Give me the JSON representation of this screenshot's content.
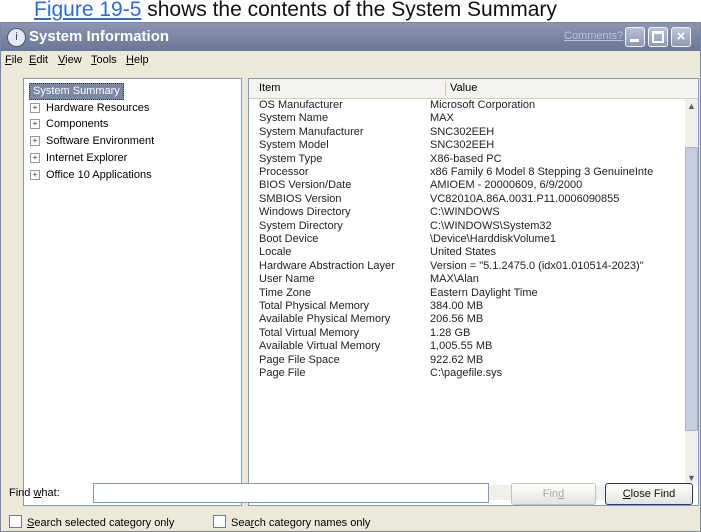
{
  "caption": {
    "link": "Figure 19-5",
    "text": " shows the contents of the System Summary"
  },
  "window": {
    "title": "System Information",
    "comments_link": "Comments?",
    "buttons": {
      "minimize_icon": "minimize-icon",
      "maximize_icon": "maximize-icon",
      "close_icon": "close-icon",
      "close_glyph": "×"
    }
  },
  "menu": {
    "file": {
      "u": "F",
      "rest": "ile"
    },
    "edit": {
      "u": "E",
      "rest": "dit"
    },
    "view": {
      "u": "V",
      "rest": "iew"
    },
    "tools": {
      "u": "T",
      "rest": "ools"
    },
    "help": {
      "u": "H",
      "rest": "elp"
    }
  },
  "tree": {
    "root": "System Summary",
    "expander": "+",
    "items": [
      "Hardware Resources",
      "Components",
      "Software Environment",
      "Internet Explorer",
      "Office 10 Applications"
    ]
  },
  "table": {
    "headers": [
      "Item",
      "Value"
    ],
    "rows": [
      [
        "OS Manufacturer",
        "Microsoft Corporation"
      ],
      [
        "System Name",
        "MAX"
      ],
      [
        "System Manufacturer",
        "SNC302EEH"
      ],
      [
        "System Model",
        "SNC302EEH"
      ],
      [
        "System Type",
        "X86-based PC"
      ],
      [
        "Processor",
        "x86 Family 6 Model 8 Stepping 3 GenuineInte"
      ],
      [
        "BIOS Version/Date",
        "AMIOEM - 20000609, 6/9/2000"
      ],
      [
        "SMBIOS Version",
        "VC82010A.86A.0031.P11.0006090855"
      ],
      [
        "Windows Directory",
        "C:\\WINDOWS"
      ],
      [
        "System Directory",
        "C:\\WINDOWS\\System32"
      ],
      [
        "Boot Device",
        "\\Device\\HarddiskVolume1"
      ],
      [
        "Locale",
        "United States"
      ],
      [
        "Hardware Abstraction Layer",
        "Version = \"5.1.2475.0 (idx01.010514-2023)\""
      ],
      [
        "User Name",
        "MAX\\Alan"
      ],
      [
        "Time Zone",
        "Eastern Daylight Time"
      ],
      [
        "Total Physical Memory",
        "384.00 MB"
      ],
      [
        "Available Physical Memory",
        "206.56 MB"
      ],
      [
        "Total Virtual Memory",
        "1.28 GB"
      ],
      [
        "Available Virtual Memory",
        "1,005.55 MB"
      ],
      [
        "Page File Space",
        "922.62 MB"
      ],
      [
        "Page File",
        "C:\\pagefile.sys"
      ]
    ]
  },
  "find": {
    "label": {
      "pre": "Find ",
      "u": "w",
      "post": "hat:"
    },
    "value": "",
    "find_button": {
      "pre": "Fin",
      "u": "d",
      "post": ""
    },
    "close_button": {
      "pre": "",
      "u": "C",
      "post": "lose Find"
    },
    "option1": {
      "pre": "",
      "u": "S",
      "post": "earch selected category only"
    },
    "option2": {
      "pre": "Sea",
      "u": "r",
      "post": "ch category names only"
    }
  }
}
